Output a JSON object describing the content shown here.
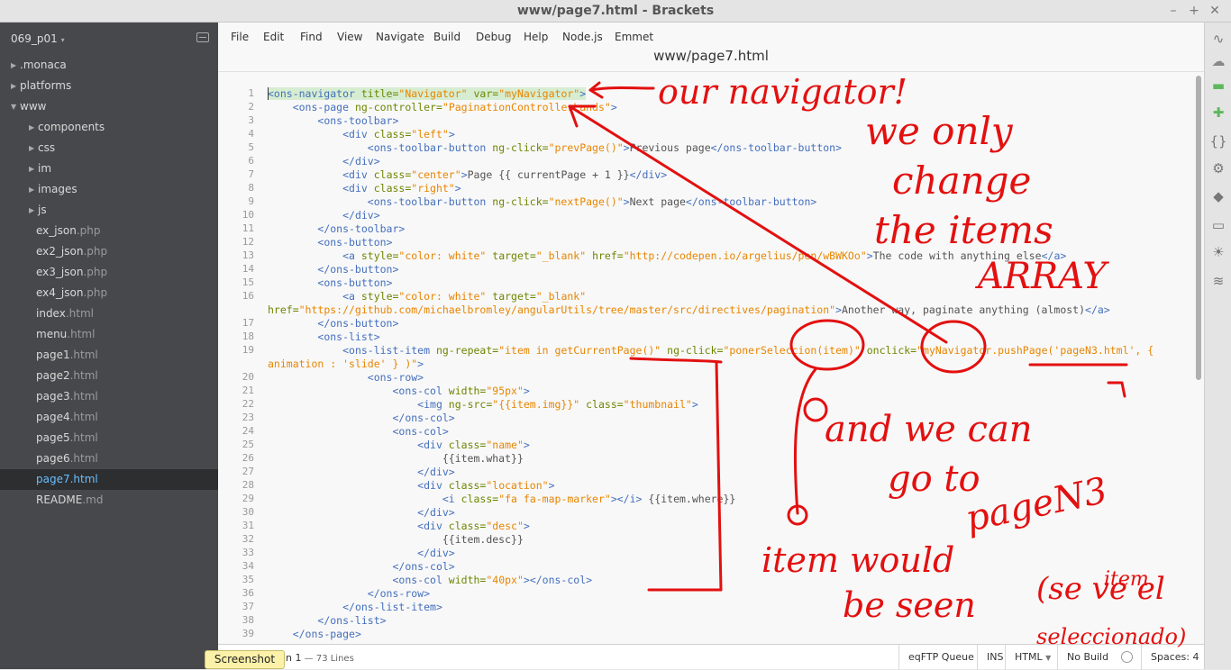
{
  "window": {
    "title": "www/page7.html - Brackets"
  },
  "sidebar": {
    "project": "069_p01",
    "items": [
      {
        "name": ".monaca",
        "ext": "",
        "folder": true,
        "depth": 0,
        "open": false
      },
      {
        "name": "platforms",
        "ext": "",
        "folder": true,
        "depth": 0,
        "open": false
      },
      {
        "name": "www",
        "ext": "",
        "folder": true,
        "depth": 0,
        "open": true
      },
      {
        "name": "components",
        "ext": "",
        "folder": true,
        "depth": 1,
        "open": false
      },
      {
        "name": "css",
        "ext": "",
        "folder": true,
        "depth": 1,
        "open": false
      },
      {
        "name": "im",
        "ext": "",
        "folder": true,
        "depth": 1,
        "open": false
      },
      {
        "name": "images",
        "ext": "",
        "folder": true,
        "depth": 1,
        "open": false
      },
      {
        "name": "js",
        "ext": "",
        "folder": true,
        "depth": 1,
        "open": false
      },
      {
        "name": "ex_json",
        "ext": ".php",
        "folder": false,
        "depth": 1
      },
      {
        "name": "ex2_json",
        "ext": ".php",
        "folder": false,
        "depth": 1
      },
      {
        "name": "ex3_json",
        "ext": ".php",
        "folder": false,
        "depth": 1
      },
      {
        "name": "ex4_json",
        "ext": ".php",
        "folder": false,
        "depth": 1
      },
      {
        "name": "index",
        "ext": ".html",
        "folder": false,
        "depth": 1
      },
      {
        "name": "menu",
        "ext": ".html",
        "folder": false,
        "depth": 1
      },
      {
        "name": "page1",
        "ext": ".html",
        "folder": false,
        "depth": 1
      },
      {
        "name": "page2",
        "ext": ".html",
        "folder": false,
        "depth": 1
      },
      {
        "name": "page3",
        "ext": ".html",
        "folder": false,
        "depth": 1
      },
      {
        "name": "page4",
        "ext": ".html",
        "folder": false,
        "depth": 1
      },
      {
        "name": "page5",
        "ext": ".html",
        "folder": false,
        "depth": 1
      },
      {
        "name": "page6",
        "ext": ".html",
        "folder": false,
        "depth": 1
      },
      {
        "name": "page7",
        "ext": ".html",
        "folder": false,
        "depth": 1,
        "selected": true
      },
      {
        "name": "README",
        "ext": ".md",
        "folder": false,
        "depth": 1
      }
    ]
  },
  "menu": [
    "File",
    "Edit",
    "Find",
    "View",
    "Navigate",
    "Build",
    "Debug",
    "Help",
    "Node.js",
    "Emmet"
  ],
  "editor": {
    "filename": "www/page7.html",
    "lines": [
      {
        "n": "1",
        "hl": true,
        "parts": [
          [
            "tg",
            "<ons-navigator "
          ],
          [
            "at",
            "title="
          ],
          [
            "st",
            "\"Navigator\""
          ],
          [
            "at",
            " var="
          ],
          [
            "st",
            "\"myNavigator\""
          ],
          [
            "tg",
            ">"
          ]
        ]
      },
      {
        "n": "2",
        "parts": [
          [
            "tx",
            "    "
          ],
          [
            "tg",
            "<ons-page "
          ],
          [
            "at",
            "ng-controller="
          ],
          [
            "st",
            "\"PaginationControllerLands\""
          ],
          [
            "tg",
            ">"
          ]
        ]
      },
      {
        "n": "3",
        "parts": [
          [
            "tx",
            "        "
          ],
          [
            "tg",
            "<ons-toolbar>"
          ]
        ]
      },
      {
        "n": "4",
        "parts": [
          [
            "tx",
            "            "
          ],
          [
            "tg",
            "<div "
          ],
          [
            "at",
            "class="
          ],
          [
            "st",
            "\"left\""
          ],
          [
            "tg",
            ">"
          ]
        ]
      },
      {
        "n": "5",
        "parts": [
          [
            "tx",
            "                "
          ],
          [
            "tg",
            "<ons-toolbar-button "
          ],
          [
            "at",
            "ng-click="
          ],
          [
            "st",
            "\"prevPage()\""
          ],
          [
            "tg",
            ">"
          ],
          [
            "tx",
            "Previous page"
          ],
          [
            "tg",
            "</ons-toolbar-button>"
          ]
        ]
      },
      {
        "n": "6",
        "parts": [
          [
            "tx",
            "            "
          ],
          [
            "tg",
            "</div>"
          ]
        ]
      },
      {
        "n": "7",
        "parts": [
          [
            "tx",
            "            "
          ],
          [
            "tg",
            "<div "
          ],
          [
            "at",
            "class="
          ],
          [
            "st",
            "\"center\""
          ],
          [
            "tg",
            ">"
          ],
          [
            "tx",
            "Page {{ currentPage + 1 }}"
          ],
          [
            "tg",
            "</div>"
          ]
        ]
      },
      {
        "n": "8",
        "parts": [
          [
            "tx",
            "            "
          ],
          [
            "tg",
            "<div "
          ],
          [
            "at",
            "class="
          ],
          [
            "st",
            "\"right\""
          ],
          [
            "tg",
            ">"
          ]
        ]
      },
      {
        "n": "9",
        "parts": [
          [
            "tx",
            "                "
          ],
          [
            "tg",
            "<ons-toolbar-button "
          ],
          [
            "at",
            "ng-click="
          ],
          [
            "st",
            "\"nextPage()\""
          ],
          [
            "tg",
            ">"
          ],
          [
            "tx",
            "Next page"
          ],
          [
            "tg",
            "</ons-toolbar-button>"
          ]
        ]
      },
      {
        "n": "10",
        "parts": [
          [
            "tx",
            "            "
          ],
          [
            "tg",
            "</div>"
          ]
        ]
      },
      {
        "n": "11",
        "parts": [
          [
            "tx",
            "        "
          ],
          [
            "tg",
            "</ons-toolbar>"
          ]
        ]
      },
      {
        "n": "12",
        "parts": [
          [
            "tx",
            "        "
          ],
          [
            "tg",
            "<ons-button>"
          ]
        ]
      },
      {
        "n": "13",
        "parts": [
          [
            "tx",
            "            "
          ],
          [
            "tg",
            "<a "
          ],
          [
            "at",
            "style="
          ],
          [
            "st",
            "\"color: white\""
          ],
          [
            "at",
            " target="
          ],
          [
            "st",
            "\"_blank\""
          ],
          [
            "at",
            " href="
          ],
          [
            "st",
            "\"http://codepen.io/argelius/pen/wBWKOo\""
          ],
          [
            "tg",
            ">"
          ],
          [
            "tx",
            "The code with anything else"
          ],
          [
            "tg",
            "</a>"
          ]
        ]
      },
      {
        "n": "14",
        "parts": [
          [
            "tx",
            "        "
          ],
          [
            "tg",
            "</ons-button>"
          ]
        ]
      },
      {
        "n": "15",
        "parts": [
          [
            "tx",
            "        "
          ],
          [
            "tg",
            "<ons-button>"
          ]
        ]
      },
      {
        "n": "16",
        "parts": [
          [
            "tx",
            "            "
          ],
          [
            "tg",
            "<a "
          ],
          [
            "at",
            "style="
          ],
          [
            "st",
            "\"color: white\""
          ],
          [
            "at",
            " target="
          ],
          [
            "st",
            "\"_blank\""
          ]
        ]
      },
      {
        "n": "",
        "parts": [
          [
            "at",
            "href="
          ],
          [
            "st",
            "\"https://github.com/michaelbromley/angularUtils/tree/master/src/directives/pagination\""
          ],
          [
            "tg",
            ">"
          ],
          [
            "tx",
            "Another way, paginate anything (almost)"
          ],
          [
            "tg",
            "</a>"
          ]
        ]
      },
      {
        "n": "17",
        "parts": [
          [
            "tx",
            "        "
          ],
          [
            "tg",
            "</ons-button>"
          ]
        ]
      },
      {
        "n": "18",
        "parts": [
          [
            "tx",
            "        "
          ],
          [
            "tg",
            "<ons-list>"
          ]
        ]
      },
      {
        "n": "19",
        "parts": [
          [
            "tx",
            "            "
          ],
          [
            "tg",
            "<ons-list-item "
          ],
          [
            "at",
            "ng-repeat="
          ],
          [
            "st",
            "\"item in getCurrentPage()\""
          ],
          [
            "at",
            " ng-click="
          ],
          [
            "st",
            "\"ponerSeleccion(item)\""
          ],
          [
            "at",
            " onclick="
          ],
          [
            "st",
            "\"myNavigator.pushPage('pageN3.html', {"
          ]
        ]
      },
      {
        "n": "",
        "parts": [
          [
            "st",
            "animation : 'slide' } )\""
          ],
          [
            "tg",
            ">"
          ]
        ]
      },
      {
        "n": "20",
        "parts": [
          [
            "tx",
            "                "
          ],
          [
            "tg",
            "<ons-row>"
          ]
        ]
      },
      {
        "n": "21",
        "parts": [
          [
            "tx",
            "                    "
          ],
          [
            "tg",
            "<ons-col "
          ],
          [
            "at",
            "width="
          ],
          [
            "st",
            "\"95px\""
          ],
          [
            "tg",
            ">"
          ]
        ]
      },
      {
        "n": "22",
        "parts": [
          [
            "tx",
            "                        "
          ],
          [
            "tg",
            "<img "
          ],
          [
            "at",
            "ng-src="
          ],
          [
            "st",
            "\"{{item.img}}\""
          ],
          [
            "at",
            " class="
          ],
          [
            "st",
            "\"thumbnail\""
          ],
          [
            "tg",
            ">"
          ]
        ]
      },
      {
        "n": "23",
        "parts": [
          [
            "tx",
            "                    "
          ],
          [
            "tg",
            "</ons-col>"
          ]
        ]
      },
      {
        "n": "24",
        "parts": [
          [
            "tx",
            "                    "
          ],
          [
            "tg",
            "<ons-col>"
          ]
        ]
      },
      {
        "n": "25",
        "parts": [
          [
            "tx",
            "                        "
          ],
          [
            "tg",
            "<div "
          ],
          [
            "at",
            "class="
          ],
          [
            "st",
            "\"name\""
          ],
          [
            "tg",
            ">"
          ]
        ]
      },
      {
        "n": "26",
        "parts": [
          [
            "tx",
            "                            {{item.what}}"
          ]
        ]
      },
      {
        "n": "27",
        "parts": [
          [
            "tx",
            "                        "
          ],
          [
            "tg",
            "</div>"
          ]
        ]
      },
      {
        "n": "28",
        "parts": [
          [
            "tx",
            "                        "
          ],
          [
            "tg",
            "<div "
          ],
          [
            "at",
            "class="
          ],
          [
            "st",
            "\"location\""
          ],
          [
            "tg",
            ">"
          ]
        ]
      },
      {
        "n": "29",
        "parts": [
          [
            "tx",
            "                            "
          ],
          [
            "tg",
            "<i "
          ],
          [
            "at",
            "class="
          ],
          [
            "st",
            "\"fa fa-map-marker\""
          ],
          [
            "tg",
            "></i>"
          ],
          [
            "tx",
            " {{item.where}}"
          ]
        ]
      },
      {
        "n": "30",
        "parts": [
          [
            "tx",
            "                        "
          ],
          [
            "tg",
            "</div>"
          ]
        ]
      },
      {
        "n": "31",
        "parts": [
          [
            "tx",
            "                        "
          ],
          [
            "tg",
            "<div "
          ],
          [
            "at",
            "class="
          ],
          [
            "st",
            "\"desc\""
          ],
          [
            "tg",
            ">"
          ]
        ]
      },
      {
        "n": "32",
        "parts": [
          [
            "tx",
            "                            {{item.desc}}"
          ]
        ]
      },
      {
        "n": "33",
        "parts": [
          [
            "tx",
            "                        "
          ],
          [
            "tg",
            "</div>"
          ]
        ]
      },
      {
        "n": "34",
        "parts": [
          [
            "tx",
            "                    "
          ],
          [
            "tg",
            "</ons-col>"
          ]
        ]
      },
      {
        "n": "35",
        "parts": [
          [
            "tx",
            "                    "
          ],
          [
            "tg",
            "<ons-col "
          ],
          [
            "at",
            "width="
          ],
          [
            "st",
            "\"40px\""
          ],
          [
            "tg",
            "></ons-col>"
          ]
        ]
      },
      {
        "n": "36",
        "parts": [
          [
            "tx",
            "                "
          ],
          [
            "tg",
            "</ons-row>"
          ]
        ]
      },
      {
        "n": "37",
        "parts": [
          [
            "tx",
            "            "
          ],
          [
            "tg",
            "</ons-list-item>"
          ]
        ]
      },
      {
        "n": "38",
        "parts": [
          [
            "tx",
            "        "
          ],
          [
            "tg",
            "</ons-list>"
          ]
        ]
      },
      {
        "n": "39",
        "parts": [
          [
            "tx",
            "    "
          ],
          [
            "tg",
            "</ons-page>"
          ]
        ]
      }
    ]
  },
  "status": {
    "cursor": "n 1",
    "lines": " — 73 Lines",
    "ftp": "eqFTP Queue",
    "mode": "INS",
    "lang": "HTML",
    "build": "No Build",
    "spaces": "Spaces:  4",
    "screenshot": "Screenshot"
  },
  "annotations": {
    "color": "#e31010",
    "texts": [
      "our navigator!",
      "we only",
      "change",
      "the items",
      "ARRAY",
      "and we can",
      "go to",
      "pageN3",
      "item would",
      "be seen",
      "(se ve el",
      "item",
      "seleccionado)"
    ]
  },
  "toolbar_icons": [
    "live-preview-icon",
    "extension-manager-icon",
    "extension-green-icon",
    "gift-icon",
    "braces-icon",
    "gamepad-icon",
    "git-icon",
    "folder-icon",
    "lightbulb-icon",
    "layers-icon"
  ]
}
